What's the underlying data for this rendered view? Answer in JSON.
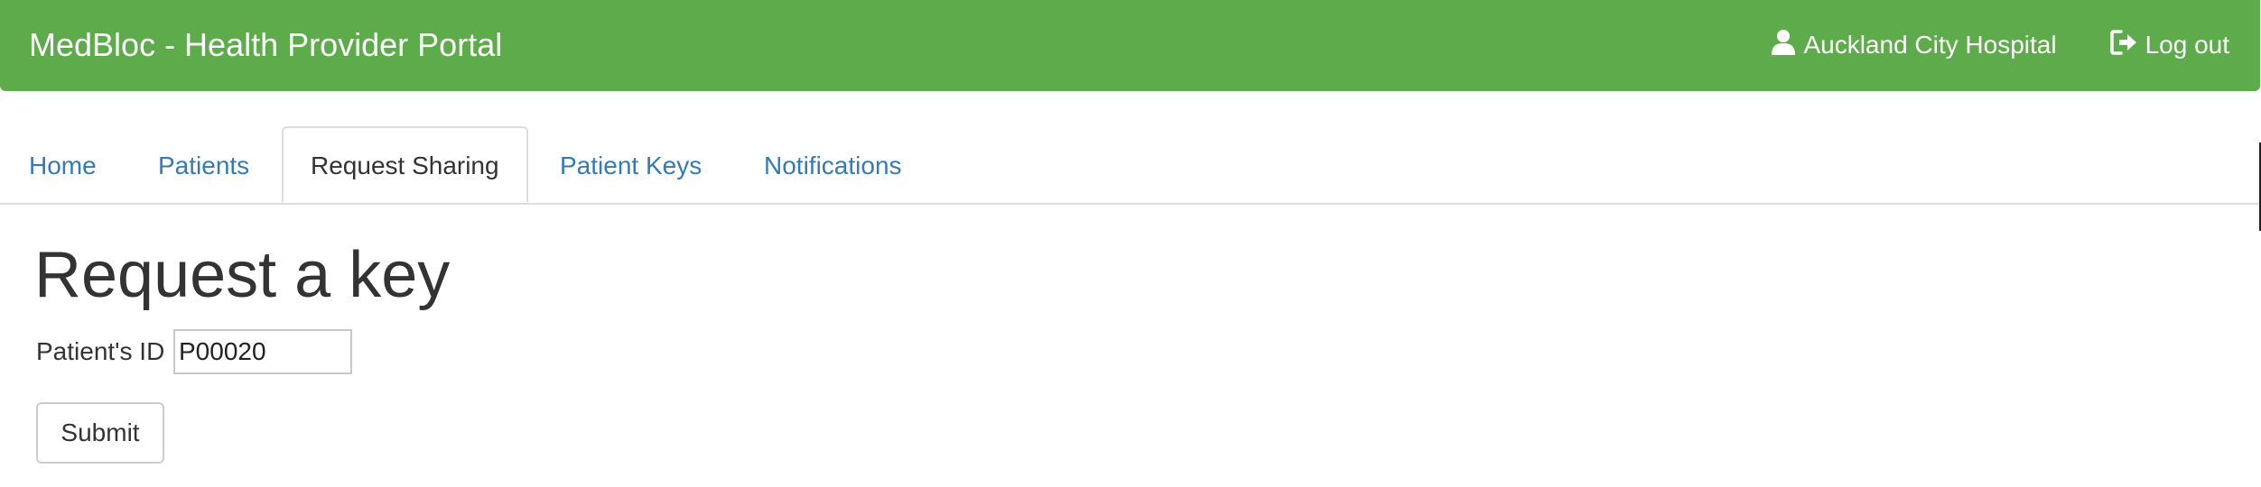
{
  "navbar": {
    "brand": "MedBloc - Health Provider Portal",
    "user_icon": "user-icon",
    "user_label": "Auckland City Hospital",
    "logout_icon": "log-out-icon",
    "logout_label": "Log out",
    "background_color": "#5eab4c"
  },
  "tabs": [
    {
      "label": "Home"
    },
    {
      "label": "Patients"
    },
    {
      "label": "Request Sharing",
      "active": true
    },
    {
      "label": "Patient Keys"
    },
    {
      "label": "Notifications"
    }
  ],
  "main": {
    "title": "Request a key",
    "field_label": "Patient's ID",
    "field_value": "P00020",
    "submit_label": "Submit"
  },
  "colors": {
    "link": "#337ab7",
    "text": "#333333"
  }
}
